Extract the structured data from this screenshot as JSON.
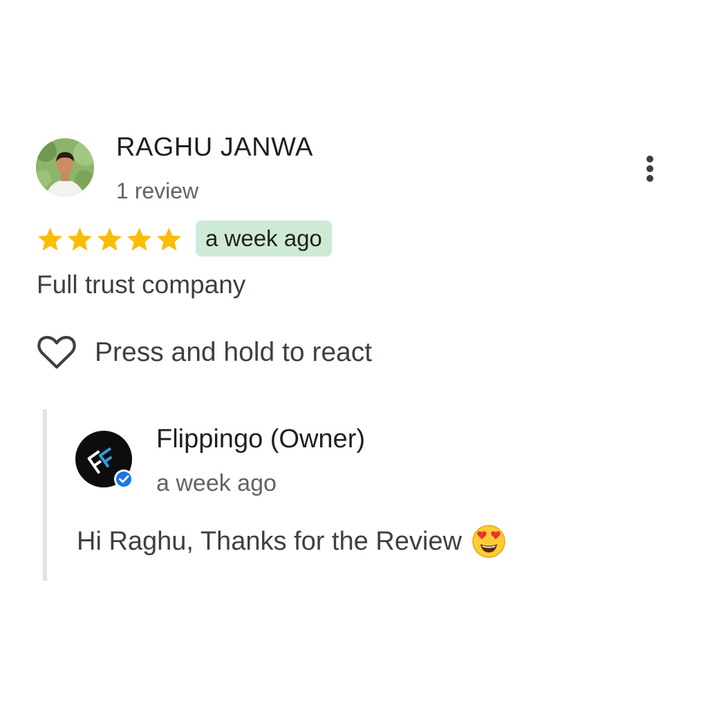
{
  "review": {
    "reviewer_name": "RAGHU JANWA",
    "review_count": "1 review",
    "rating": 5,
    "rating_max": 5,
    "time_ago": "a week ago",
    "text": "Full trust company",
    "react_label": "Press and hold to react",
    "icons": {
      "more": "more-vert-icon",
      "star": "star-icon",
      "heart": "heart-outline-icon"
    },
    "colors": {
      "star": "#fbbc04",
      "time_badge_bg": "#ceead6"
    }
  },
  "owner_reply": {
    "name": "Flippingo (Owner)",
    "time_ago": "a week ago",
    "text": "Hi Raghu, Thanks for the Review",
    "emoji": "heart-eyes-emoji",
    "icons": {
      "verified": "verified-badge-icon"
    },
    "colors": {
      "verified": "#1a73e8",
      "logo_bg": "#0d0d0d",
      "logo_accent": "#29a3e0"
    }
  }
}
